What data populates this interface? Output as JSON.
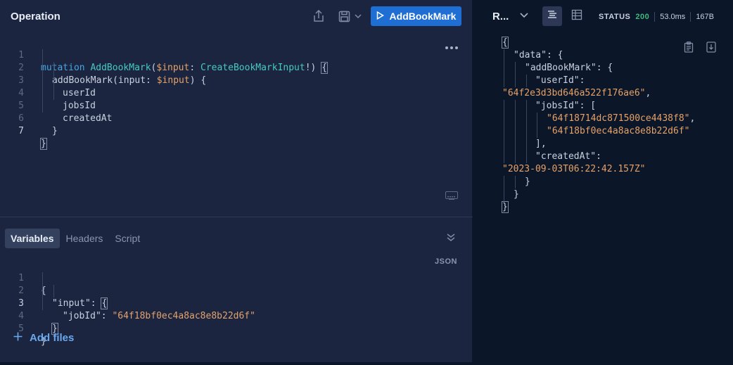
{
  "operation": {
    "title": "Operation",
    "run_button_label": "AddBookMark",
    "editor_lines": [
      {
        "num": "1",
        "active": false
      },
      {
        "num": "2",
        "active": false
      },
      {
        "num": "3",
        "active": false
      },
      {
        "num": "4",
        "active": false
      },
      {
        "num": "5",
        "active": false
      },
      {
        "num": "6",
        "active": false
      },
      {
        "num": "7",
        "active": true
      }
    ],
    "tokens": {
      "l1_mutation": "mutation",
      "l1_name": "AddBookMark",
      "l1_paren_open": "(",
      "l1_var": "$input",
      "l1_colon": ": ",
      "l1_type": "CreateBookMarkInput",
      "l1_rest": "!) ",
      "l1_brace": "{",
      "l2_field": "addBookMark",
      "l2_args_open": "(input: ",
      "l2_var": "$input",
      "l2_args_close": ") {",
      "l3": "userId",
      "l4": "jobsId",
      "l5": "createdAt",
      "l6": "}",
      "l7": "}"
    }
  },
  "variables_panel": {
    "tabs": [
      {
        "label": "Variables",
        "active": true
      },
      {
        "label": "Headers",
        "active": false
      },
      {
        "label": "Script",
        "active": false
      }
    ],
    "json_label": "JSON",
    "line_numbers": [
      "1",
      "2",
      "3",
      "4",
      "5"
    ],
    "active_line": "3",
    "tokens": {
      "l1": "{",
      "l2_key": "\"input\"",
      "l2_colon": ": ",
      "l2_brace": "{",
      "l3_key": "\"jobId\"",
      "l3_colon": ": ",
      "l3_value": "\"64f18bf0ec4a8ac8e8b22d6f\"",
      "l4": "}",
      "l5": "}"
    },
    "add_files_label": "Add files"
  },
  "response": {
    "title": "R...",
    "status_label": "STATUS",
    "status_code": "200",
    "duration": "53.0ms",
    "size": "167B",
    "lines": {
      "l1": "{",
      "l2_key": "\"data\"",
      "l2_rest": ": {",
      "l3_key": "\"addBookMark\"",
      "l3_rest": ": {",
      "l4_key": "\"userId\"",
      "l4_rest": ":",
      "l5_value": "\"64f2e3d3bd646a522f176ae6\"",
      "l5_rest": ",",
      "l6_key": "\"jobsId\"",
      "l6_rest": ": [",
      "l7_value": "\"64f18714dc871500ce4438f8\"",
      "l7_rest": ",",
      "l8_value": "\"64f18bf0ec4a8ac8e8b22d6f\"",
      "l9": "],",
      "l10_key": "\"createdAt\"",
      "l10_rest": ":",
      "l11_value": "\"2023-09-03T06:22:42.157Z\"",
      "l12": "}",
      "l13": "}",
      "l14": "}"
    }
  },
  "colors": {
    "run_button": "#1f6ed4",
    "status_ok": "#3dba7d",
    "string": "#e5a26a",
    "type": "#47c9c0"
  }
}
